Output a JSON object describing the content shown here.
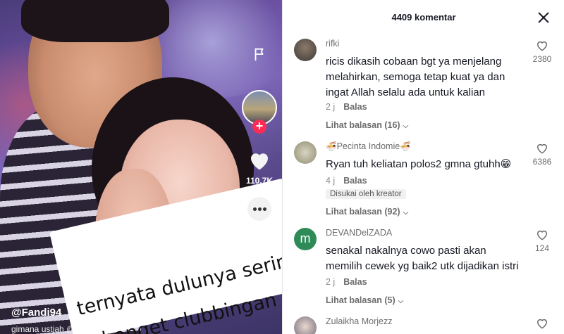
{
  "video": {
    "caption_line1": "ternyata dulunya sering",
    "caption_line2": "banget clubbingan",
    "username": "@Fandi94",
    "description": "gimana ustjah @",
    "like_count": "110.7K",
    "comment_count": "4409",
    "icons": {
      "flag": "flag-icon",
      "like": "heart-icon",
      "comment": "comment-bubble-icon",
      "follow": "plus-icon"
    }
  },
  "comments_panel": {
    "title": "4409 komentar",
    "close_icon": "close-icon",
    "items": [
      {
        "user": "rifki",
        "text": "ricis dikasih cobaan bgt ya menjelang melahirkan, semoga tetap kuat ya dan ingat Allah selalu ada untuk kalian",
        "time": "2 j",
        "reply_label": "Balas",
        "view_replies": "Lihat balasan (16)",
        "likes": "2380",
        "avatar_color": "#3d3a36"
      },
      {
        "user": "🍜Pecinta Indomie🍜",
        "text": "Ryan tuh keliatan polos2 gmna gtuhh😁",
        "time": "4 j",
        "reply_label": "Balas",
        "badge": "Disukai oleh kreator",
        "view_replies": "Lihat balasan (92)",
        "likes": "6386",
        "avatar_color": "#b9b6a0"
      },
      {
        "user": "DEVANDelZADA",
        "text": "senakal nakalnya cowo pasti akan memilih cewek yg baik2 utk dijadikan istri",
        "time": "2 j",
        "reply_label": "Balas",
        "view_replies": "Lihat balasan (5)",
        "likes": "124",
        "avatar_letter": "m",
        "avatar_color": "#2e8b57"
      },
      {
        "user": "Zulaikha Morjezz",
        "text": "",
        "likes": "",
        "avatar_color": "#9a9aa8"
      }
    ]
  }
}
